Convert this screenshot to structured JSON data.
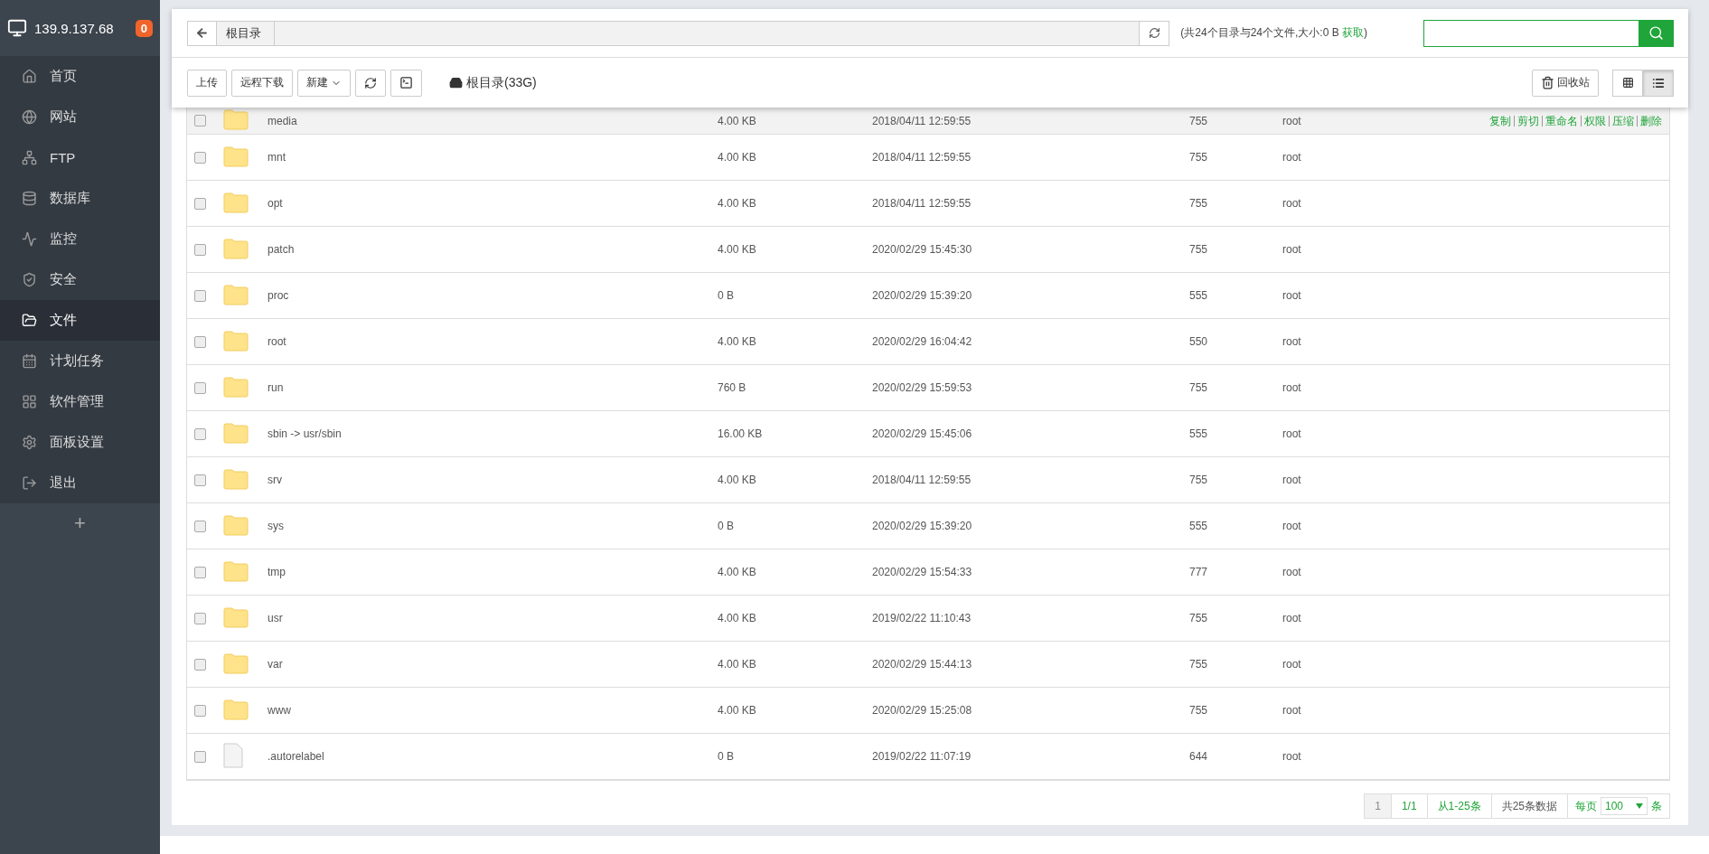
{
  "sidebar": {
    "host": "139.9.137.68",
    "badge": "0",
    "items": [
      {
        "label": "首页",
        "selected": false
      },
      {
        "label": "网站",
        "selected": false
      },
      {
        "label": "FTP",
        "selected": false
      },
      {
        "label": "数据库",
        "selected": false
      },
      {
        "label": "监控",
        "selected": false
      },
      {
        "label": "安全",
        "selected": false
      },
      {
        "label": "文件",
        "selected": true
      },
      {
        "label": "计划任务",
        "selected": false
      },
      {
        "label": "软件管理",
        "selected": false
      },
      {
        "label": "面板设置",
        "selected": false
      },
      {
        "label": "退出",
        "selected": false
      }
    ],
    "add": "+"
  },
  "path": {
    "crumbs": [
      "根目录"
    ],
    "summary": "(共24个目录与24个文件,大小:0 B ",
    "summary_link": "获取",
    "summary_end": ")"
  },
  "toolbar": {
    "buttons": [
      {
        "label": "上传",
        "kind": "text"
      },
      {
        "label": "远程下载",
        "kind": "text"
      },
      {
        "label": "新建",
        "kind": "dropdown"
      },
      {
        "kind": "refresh"
      },
      {
        "kind": "terminal"
      }
    ],
    "disk": "根目录(33G)",
    "recycle": "回收站",
    "views": [
      {
        "kind": "grid",
        "selected": false
      },
      {
        "kind": "list",
        "selected": true
      }
    ]
  },
  "files": [
    {
      "kind": "folder",
      "name": "media",
      "size": "4.00 KB",
      "modified": "2018/04/11 12:59:55",
      "perms": "755",
      "owner": "root",
      "checked": false,
      "hovered": true,
      "actions": [
        "复制",
        "剪切",
        "重命名",
        "权限",
        "压缩",
        "删除"
      ]
    },
    {
      "kind": "folder",
      "name": "mnt",
      "size": "4.00 KB",
      "modified": "2018/04/11 12:59:55",
      "perms": "755",
      "owner": "root",
      "checked": false,
      "hovered": false
    },
    {
      "kind": "folder",
      "name": "opt",
      "size": "4.00 KB",
      "modified": "2018/04/11 12:59:55",
      "perms": "755",
      "owner": "root",
      "checked": false,
      "hovered": false
    },
    {
      "kind": "folder",
      "name": "patch",
      "size": "4.00 KB",
      "modified": "2020/02/29 15:45:30",
      "perms": "755",
      "owner": "root",
      "checked": false,
      "hovered": false
    },
    {
      "kind": "folder",
      "name": "proc",
      "size": "0 B",
      "modified": "2020/02/29 15:39:20",
      "perms": "555",
      "owner": "root",
      "checked": false,
      "hovered": false
    },
    {
      "kind": "folder",
      "name": "root",
      "size": "4.00 KB",
      "modified": "2020/02/29 16:04:42",
      "perms": "550",
      "owner": "root",
      "checked": false,
      "hovered": false
    },
    {
      "kind": "folder",
      "name": "run",
      "size": "760 B",
      "modified": "2020/02/29 15:59:53",
      "perms": "755",
      "owner": "root",
      "checked": false,
      "hovered": false
    },
    {
      "kind": "folder",
      "name": "sbin -> usr/sbin",
      "size": "16.00 KB",
      "modified": "2020/02/29 15:45:06",
      "perms": "555",
      "owner": "root",
      "checked": false,
      "hovered": false
    },
    {
      "kind": "folder",
      "name": "srv",
      "size": "4.00 KB",
      "modified": "2018/04/11 12:59:55",
      "perms": "755",
      "owner": "root",
      "checked": false,
      "hovered": false
    },
    {
      "kind": "folder",
      "name": "sys",
      "size": "0 B",
      "modified": "2020/02/29 15:39:20",
      "perms": "555",
      "owner": "root",
      "checked": false,
      "hovered": false
    },
    {
      "kind": "folder",
      "name": "tmp",
      "size": "4.00 KB",
      "modified": "2020/02/29 15:54:33",
      "perms": "777",
      "owner": "root",
      "checked": false,
      "hovered": false
    },
    {
      "kind": "folder",
      "name": "usr",
      "size": "4.00 KB",
      "modified": "2019/02/22 11:10:43",
      "perms": "755",
      "owner": "root",
      "checked": false,
      "hovered": false
    },
    {
      "kind": "folder",
      "name": "var",
      "size": "4.00 KB",
      "modified": "2020/02/29 15:44:13",
      "perms": "755",
      "owner": "root",
      "checked": false,
      "hovered": false
    },
    {
      "kind": "folder",
      "name": "www",
      "size": "4.00 KB",
      "modified": "2020/02/29 15:25:08",
      "perms": "755",
      "owner": "root",
      "checked": false,
      "hovered": false
    },
    {
      "kind": "file",
      "name": ".autorelabel",
      "size": "0 B",
      "modified": "2019/02/22 11:07:19",
      "perms": "644",
      "owner": "root",
      "checked": false,
      "hovered": false
    }
  ],
  "pagination": {
    "items": [
      {
        "label": "1",
        "kind": "current"
      },
      {
        "label": "1/1",
        "kind": "link"
      },
      {
        "label": "从1-25条",
        "kind": "link"
      },
      {
        "label": "共25条数据",
        "kind": "text"
      }
    ],
    "per_page_label": "每页",
    "per_page": "100",
    "per_page_unit": "条"
  }
}
